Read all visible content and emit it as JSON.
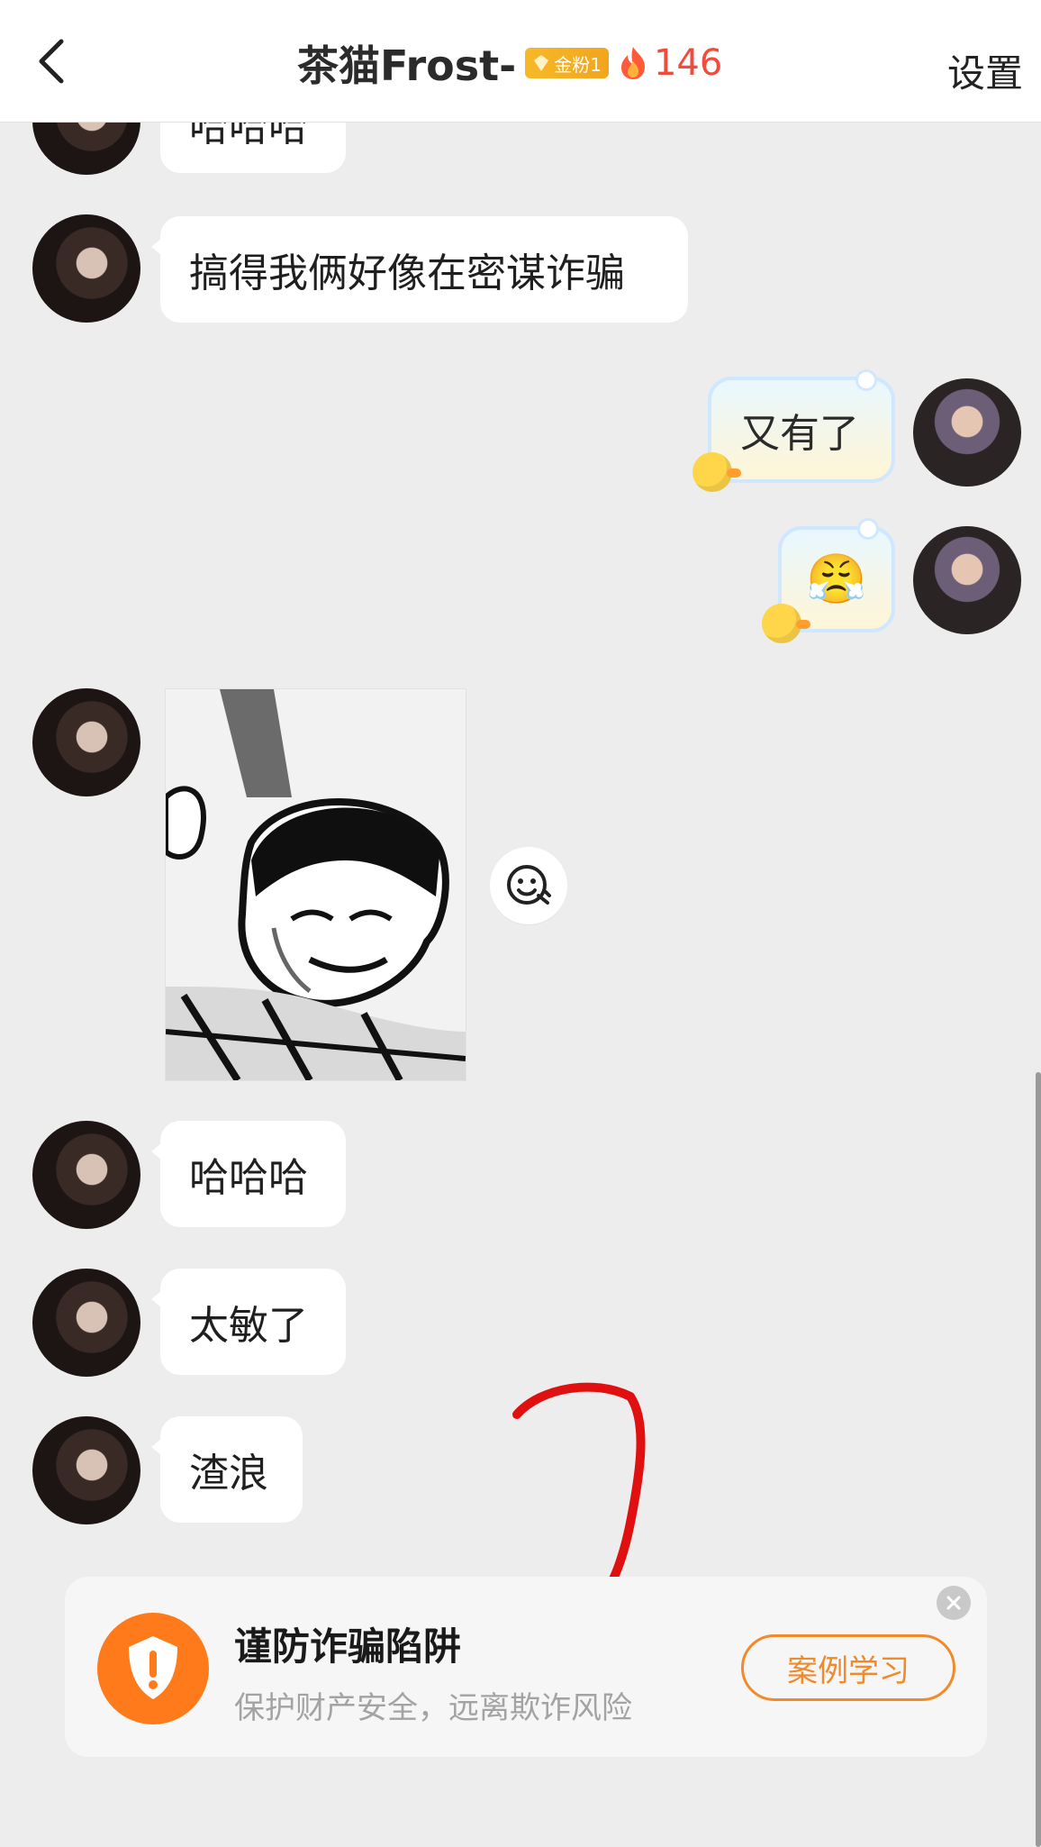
{
  "header": {
    "title": "茶猫Frost-",
    "badge_text": "金粉1",
    "fire_count": "146",
    "settings_label": "设置"
  },
  "messages": [
    {
      "side": "left",
      "text": "哈哈哈"
    },
    {
      "side": "left",
      "text": "搞得我俩好像在密谋诈骗"
    },
    {
      "side": "right",
      "text": "又有了"
    },
    {
      "side": "right",
      "text": "😤"
    },
    {
      "side": "left",
      "type": "sticker"
    },
    {
      "side": "left",
      "text": "哈哈哈"
    },
    {
      "side": "left",
      "text": "太敏了"
    },
    {
      "side": "left",
      "text": "渣浪"
    }
  ],
  "warning": {
    "title": "谨防诈骗陷阱",
    "subtitle": "保护财产安全，远离欺诈风险",
    "button_label": "案例学习"
  },
  "colors": {
    "accent_orange": "#ff7a1a",
    "fire_red": "#f04b3b",
    "badge_gold": "#f7b928",
    "annotation_red": "#e01010"
  },
  "icons": {
    "back": "chevron-left-icon",
    "badge": "diamond-icon",
    "fire": "fire-icon",
    "sticker_action": "emoji-add-icon",
    "shield": "shield-exclamation-icon",
    "close": "close-icon"
  }
}
